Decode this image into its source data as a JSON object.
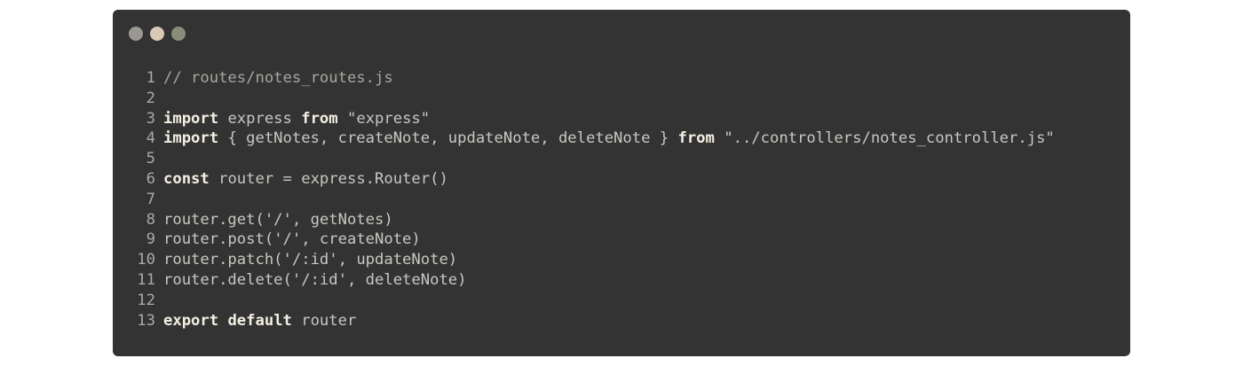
{
  "window": {
    "controls": [
      {
        "name": "close",
        "color": "#9b9893"
      },
      {
        "name": "minimize",
        "color": "#d8c8b5"
      },
      {
        "name": "maximize",
        "color": "#8a8c7b"
      }
    ]
  },
  "code": {
    "language": "javascript",
    "lines": [
      {
        "number": "1",
        "tokens": [
          {
            "type": "comment",
            "text": "// routes/notes_routes.js"
          }
        ]
      },
      {
        "number": "2",
        "tokens": []
      },
      {
        "number": "3",
        "tokens": [
          {
            "type": "keyword",
            "text": "import"
          },
          {
            "type": "plain",
            "text": " express "
          },
          {
            "type": "keyword",
            "text": "from"
          },
          {
            "type": "plain",
            "text": " "
          },
          {
            "type": "string",
            "text": "\"express\""
          }
        ]
      },
      {
        "number": "4",
        "tokens": [
          {
            "type": "keyword",
            "text": "import"
          },
          {
            "type": "plain",
            "text": " { getNotes, createNote, updateNote, deleteNote } "
          },
          {
            "type": "keyword",
            "text": "from"
          },
          {
            "type": "plain",
            "text": " "
          },
          {
            "type": "string",
            "text": "\"../controllers/notes_controller.js\""
          }
        ]
      },
      {
        "number": "5",
        "tokens": []
      },
      {
        "number": "6",
        "tokens": [
          {
            "type": "keyword",
            "text": "const"
          },
          {
            "type": "plain",
            "text": " router = express.Router()"
          }
        ]
      },
      {
        "number": "7",
        "tokens": []
      },
      {
        "number": "8",
        "tokens": [
          {
            "type": "plain",
            "text": "router.get("
          },
          {
            "type": "string",
            "text": "'/'"
          },
          {
            "type": "plain",
            "text": ", getNotes)"
          }
        ]
      },
      {
        "number": "9",
        "tokens": [
          {
            "type": "plain",
            "text": "router.post("
          },
          {
            "type": "string",
            "text": "'/'"
          },
          {
            "type": "plain",
            "text": ", createNote)"
          }
        ]
      },
      {
        "number": "10",
        "tokens": [
          {
            "type": "plain",
            "text": "router.patch("
          },
          {
            "type": "string",
            "text": "'/:id'"
          },
          {
            "type": "plain",
            "text": ", updateNote)"
          }
        ]
      },
      {
        "number": "11",
        "tokens": [
          {
            "type": "plain",
            "text": "router.delete("
          },
          {
            "type": "string",
            "text": "'/:id'"
          },
          {
            "type": "plain",
            "text": ", deleteNote)"
          }
        ]
      },
      {
        "number": "12",
        "tokens": []
      },
      {
        "number": "13",
        "tokens": [
          {
            "type": "keyword",
            "text": "export"
          },
          {
            "type": "plain",
            "text": " "
          },
          {
            "type": "keyword",
            "text": "default"
          },
          {
            "type": "plain",
            "text": " router"
          }
        ]
      }
    ]
  }
}
